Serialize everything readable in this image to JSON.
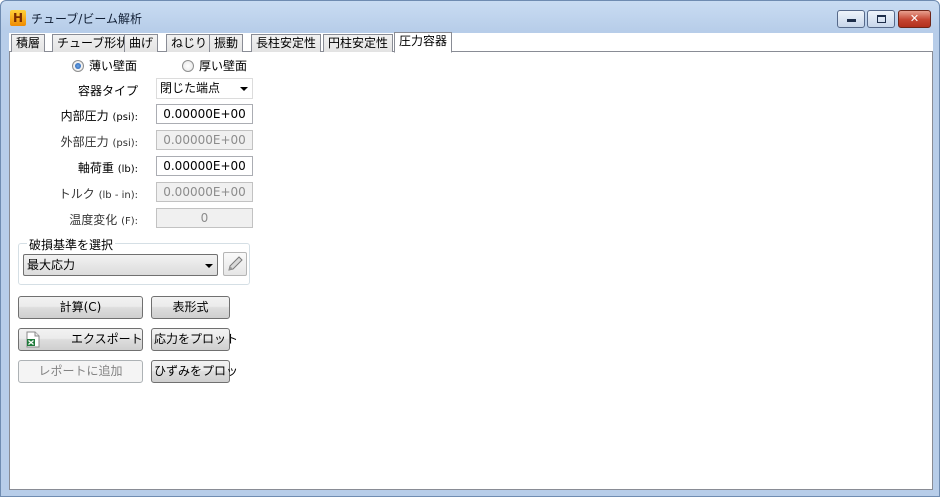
{
  "window": {
    "title": "チューブ/ビーム解析",
    "app_icon": "H",
    "controls": {
      "minimize": "",
      "maximize": "",
      "close": "✕"
    }
  },
  "tabs": [
    {
      "label": "積層"
    },
    {
      "label": "チューブ形状"
    },
    {
      "label": "曲げ"
    },
    {
      "label": "ねじり"
    },
    {
      "label": "振動"
    },
    {
      "label": "長柱安定性"
    },
    {
      "label": "円柱安定性"
    },
    {
      "label": "圧力容器",
      "active": true
    }
  ],
  "wall": {
    "thin_label": "薄い壁面",
    "thick_label": "厚い壁面",
    "selected": "thin"
  },
  "form": {
    "vessel_type": {
      "label": "容器タイプ",
      "value": "閉じた端点"
    },
    "internal_pressure": {
      "label": "内部圧力 ",
      "unit": "(psi):",
      "value": "0.00000E+00",
      "enabled": true
    },
    "external_pressure": {
      "label": "外部圧力 ",
      "unit": "(psi):",
      "value": "0.00000E+00",
      "enabled": false
    },
    "axial_load": {
      "label": "軸荷重 ",
      "unit": "(lb):",
      "value": "0.00000E+00",
      "enabled": true
    },
    "torque": {
      "label": "トルク ",
      "unit": "(lb - in):",
      "value": "0.00000E+00",
      "enabled": false
    },
    "temperature_change": {
      "label": "温度変化 ",
      "unit": "(F):",
      "value": "0",
      "enabled": false
    }
  },
  "failure": {
    "group_title": "破損基準を選択",
    "selected": "最大応力",
    "edit_icon": "pencil-icon"
  },
  "buttons": {
    "calculate": "計算(C)",
    "table": "表形式",
    "export": "エクスポート",
    "plot_stress": "応力をプロット",
    "add_report": "レポートに追加",
    "plot_strain": "ひずみをプロッ"
  }
}
